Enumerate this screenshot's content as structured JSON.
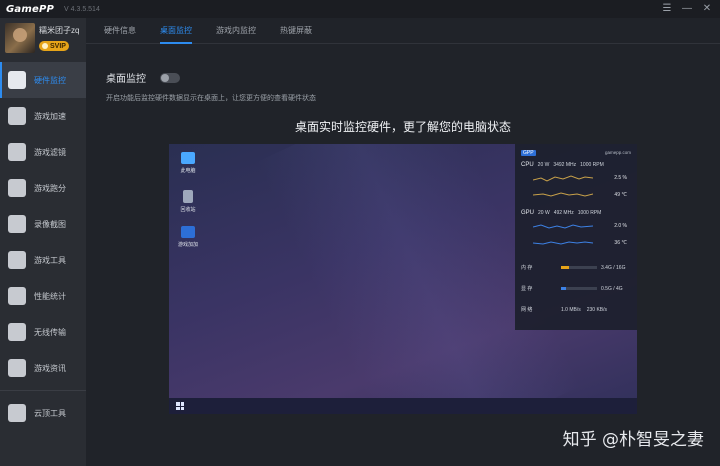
{
  "app": {
    "logo": "GamePP",
    "version": "V 4.3.5.514"
  },
  "window_controls": {
    "menu": "☰",
    "minimize": "—",
    "close": "✕"
  },
  "profile": {
    "username": "糯米团子zq",
    "badge": "SVIP"
  },
  "sidebar": {
    "items": [
      {
        "label": "硬件监控",
        "icon": "monitor-icon",
        "active": true
      },
      {
        "label": "游戏加速",
        "icon": "rocket-icon"
      },
      {
        "label": "游戏滤镜",
        "icon": "filter-icon"
      },
      {
        "label": "游戏跑分",
        "icon": "speedometer-icon"
      },
      {
        "label": "录像截图",
        "icon": "camera-icon"
      },
      {
        "label": "游戏工具",
        "icon": "toolbox-icon"
      },
      {
        "label": "性能统计",
        "icon": "chart-icon"
      },
      {
        "label": "无线传输",
        "icon": "phone-icon"
      },
      {
        "label": "游戏资讯",
        "icon": "news-icon"
      }
    ],
    "bottom": {
      "label": "云顶工具",
      "icon": "cloud-tool-icon"
    }
  },
  "tabs": [
    {
      "label": "硬件信息"
    },
    {
      "label": "桌面监控",
      "active": true
    },
    {
      "label": "游戏内监控"
    },
    {
      "label": "热键屏蔽"
    }
  ],
  "main": {
    "setting_title": "桌面监控",
    "toggle_on": false,
    "description": "开启功能后监控硬件数据显示在桌面上，让您更方便的查看硬件状态",
    "headline": "桌面实时监控硬件，更了解您的电脑状态"
  },
  "preview": {
    "desktop_icons": [
      {
        "label": "此电脑",
        "icon": "computer-icon"
      },
      {
        "label": "回收站",
        "icon": "recycle-bin-icon"
      },
      {
        "label": "游戏加加",
        "icon": "gamepp-icon"
      }
    ],
    "overlay": {
      "logo": "GPP",
      "site": "gamepp.com",
      "cpu": {
        "label": "CPU",
        "power": "20 W",
        "clock": "3492 MHz",
        "fan": "1000 RPM",
        "usage": "2.5 %",
        "temp": "49 ℃"
      },
      "gpu": {
        "label": "GPU",
        "power": "20 W",
        "clock": "492 MHz",
        "fan": "1000 RPM",
        "usage": "2.0 %",
        "temp": "36 ℃"
      },
      "memory": {
        "label": "内 存",
        "value": "3.4G / 16G",
        "fraction": 0.21,
        "color": "#e6a419"
      },
      "vram": {
        "label": "显 存",
        "value": "0.5G / 4G",
        "fraction": 0.13,
        "color": "#3d82e6"
      },
      "network": {
        "label": "网 络",
        "down": "1.0 MB/s",
        "up": "230 KB/s"
      }
    }
  },
  "watermark": "知乎 @朴智旻之妻",
  "colors": {
    "accent": "#2d8cf0",
    "svip": "#e6a419"
  }
}
